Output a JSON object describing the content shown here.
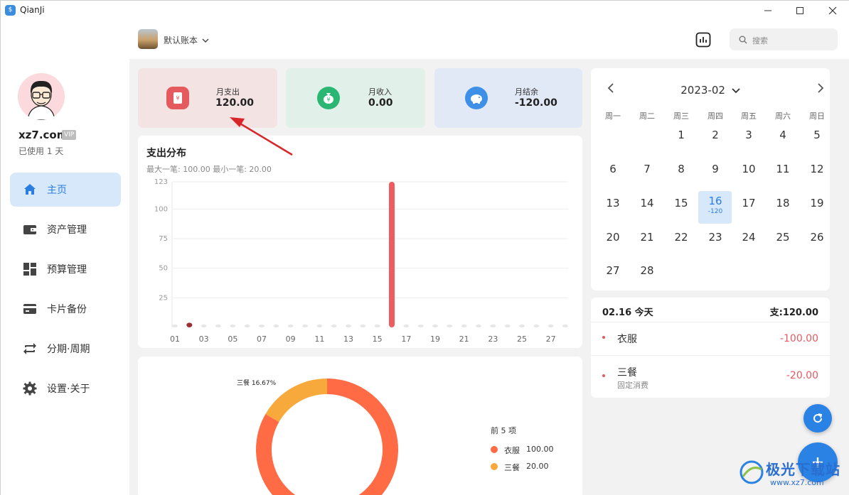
{
  "app": {
    "title": "QianJi"
  },
  "user": {
    "name": "xz7.com",
    "vip": "VIP",
    "used_days": "已使用 1 天"
  },
  "nav": [
    {
      "label": "主页",
      "icon": "home-icon",
      "active": true
    },
    {
      "label": "资产管理",
      "icon": "wallet-icon"
    },
    {
      "label": "预算管理",
      "icon": "dashboard-icon"
    },
    {
      "label": "卡片备份",
      "icon": "card-icon"
    },
    {
      "label": "分期·周期",
      "icon": "repeat-icon"
    },
    {
      "label": "设置·关于",
      "icon": "gear-icon"
    }
  ],
  "header": {
    "book_name": "默认账本",
    "search_placeholder": "搜索"
  },
  "summary": {
    "expense": {
      "label": "月支出",
      "value": "120.00",
      "color": "#f3e3e3",
      "icon_color": "#e45a5f"
    },
    "income": {
      "label": "月收入",
      "value": "0.00",
      "color": "#e1f0e8",
      "icon_color": "#2bb673"
    },
    "balance": {
      "label": "月结余",
      "value": "-120.00",
      "color": "#e1e9f6",
      "icon_color": "#3d8fe8"
    }
  },
  "spend_chart": {
    "title": "支出分布",
    "subtitle": "最大一笔: 100.00 最小一笔: 20.00"
  },
  "chart_data": [
    {
      "type": "bar",
      "x_ticks": [
        "01",
        "03",
        "05",
        "07",
        "09",
        "11",
        "13",
        "15",
        "17",
        "19",
        "21",
        "23",
        "25",
        "27"
      ],
      "y_ticks": [
        "123",
        "100",
        "75",
        "50",
        "25"
      ],
      "ylim": [
        0,
        123
      ],
      "categories": [
        "01",
        "02",
        "03",
        "04",
        "05",
        "06",
        "07",
        "08",
        "09",
        "10",
        "11",
        "12",
        "13",
        "14",
        "15",
        "16",
        "17",
        "18",
        "19",
        "20",
        "21",
        "22",
        "23",
        "24",
        "25",
        "26",
        "27",
        "28"
      ],
      "values": [
        0,
        4,
        0,
        0,
        0,
        0,
        0,
        0,
        0,
        0,
        0,
        0,
        0,
        0,
        0,
        123,
        0,
        0,
        0,
        0,
        0,
        0,
        0,
        0,
        0,
        0,
        0,
        0
      ],
      "bar_colors": {
        "02": "#9b2f34",
        "16": "#ee5b60"
      }
    },
    {
      "type": "pie",
      "title": "前 5 项",
      "slices": [
        {
          "label": "衣服",
          "value": 100.0,
          "value_text": "100.00",
          "color": "#ff6b45"
        },
        {
          "label": "三餐",
          "value": 20.0,
          "value_text": "20.00",
          "color": "#f8a93c"
        }
      ],
      "annotation": "三餐 16.67%"
    }
  ],
  "calendar": {
    "month": "2023-02",
    "weekdays": [
      "周一",
      "周二",
      "周三",
      "周四",
      "周五",
      "周六",
      "周日"
    ],
    "selected_day": "16",
    "selected_amount": "-120"
  },
  "day_detail": {
    "date": "02.16 今天",
    "total": "支:120.00",
    "items": [
      {
        "name": "衣服",
        "note": "",
        "amount": "-100.00"
      },
      {
        "name": "三餐",
        "note": "固定消费",
        "amount": "-20.00"
      }
    ]
  },
  "watermark": {
    "text": "极光下载站",
    "url": "www.xz7.com"
  }
}
